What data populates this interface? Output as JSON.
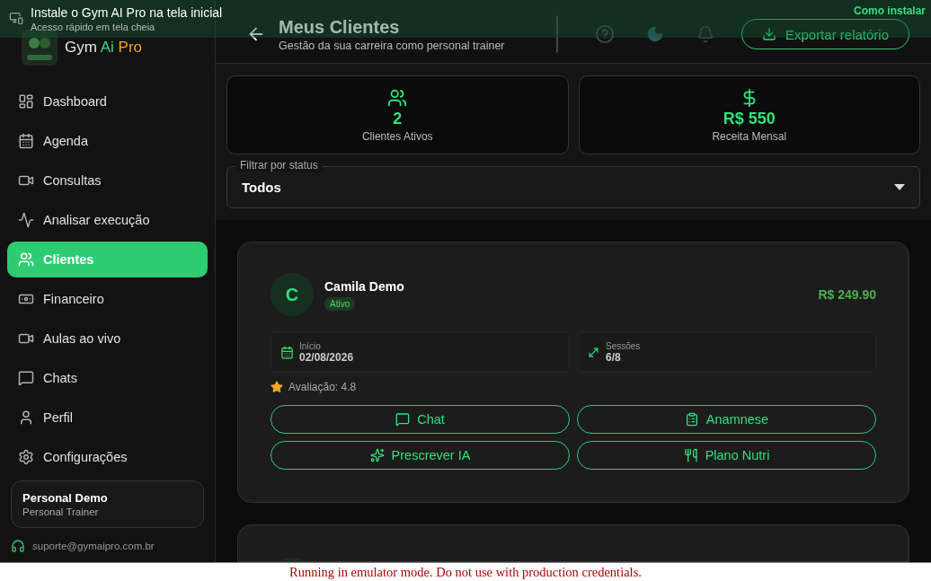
{
  "install_banner": {
    "title": "Instale o Gym AI Pro na tela inicial",
    "subtitle": "Acesso rápido em tela cheia",
    "action": "Como instalar"
  },
  "sidebar": {
    "brand": {
      "name": "Gym",
      "accent": "Ai",
      "suffix": "Pro"
    },
    "items": [
      {
        "label": "Dashboard",
        "selected": false
      },
      {
        "label": "Agenda",
        "selected": false
      },
      {
        "label": "Consultas",
        "selected": false
      },
      {
        "label": "Analisar execução",
        "selected": false
      },
      {
        "label": "Clientes",
        "selected": true
      },
      {
        "label": "Financeiro",
        "selected": false
      },
      {
        "label": "Aulas ao vivo",
        "selected": false
      },
      {
        "label": "Chats",
        "selected": false
      },
      {
        "label": "Perfil",
        "selected": false
      },
      {
        "label": "Configurações",
        "selected": false
      }
    ],
    "user": {
      "name": "Personal Demo",
      "role": "Personal Trainer"
    },
    "support": "suporte@gymaipro.com.br"
  },
  "header": {
    "title": "Meus Clientes",
    "subtitle": "Gestão da sua carreira como personal trainer",
    "export_button": "Exportar relatório"
  },
  "stats": [
    {
      "value": "2",
      "label": "Clientes Ativos"
    },
    {
      "value": "R$ 550",
      "label": "Receita Mensal"
    }
  ],
  "filter": {
    "label": "Filtrar por status",
    "value": "Todos"
  },
  "clients": [
    {
      "initial": "C",
      "name": "Camila Demo",
      "status": "Ativo",
      "price": "R$ 249.90",
      "details": [
        {
          "label": "Início",
          "value": "02/08/2026"
        },
        {
          "label": "Sessões",
          "value": "6/8"
        }
      ],
      "rating": "Avaliação: 4.8",
      "actions": [
        {
          "label": "Chat"
        },
        {
          "label": "Anamnese"
        },
        {
          "label": "Prescrever IA"
        },
        {
          "label": "Plano Nutri"
        }
      ]
    }
  ],
  "more_cards_below": true,
  "emulator_notice": "Running in emulator mode. Do not use with production credentials."
}
